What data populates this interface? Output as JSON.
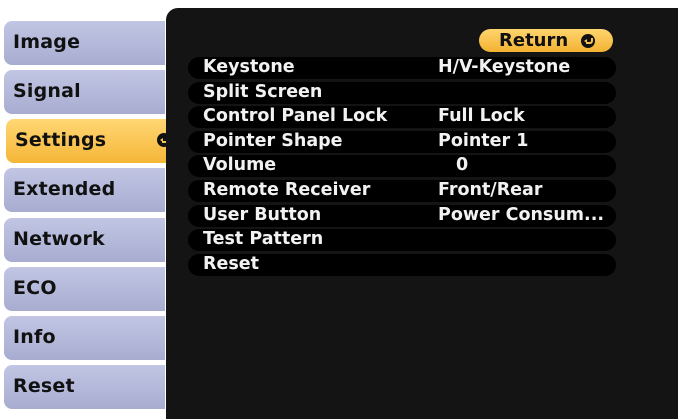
{
  "sidebar": {
    "tabs": [
      {
        "label": "Image",
        "active": false
      },
      {
        "label": "Signal",
        "active": false
      },
      {
        "label": "Settings",
        "active": true
      },
      {
        "label": "Extended",
        "active": false
      },
      {
        "label": "Network",
        "active": false
      },
      {
        "label": "ECO",
        "active": false
      },
      {
        "label": "Info",
        "active": false
      },
      {
        "label": "Reset",
        "active": false
      }
    ]
  },
  "main": {
    "return_label": "Return",
    "items": [
      {
        "label": "Keystone",
        "value": "H/V-Keystone"
      },
      {
        "label": "Split Screen",
        "value": ""
      },
      {
        "label": "Control Panel Lock",
        "value": "Full Lock"
      },
      {
        "label": "Pointer Shape",
        "value": "Pointer 1"
      },
      {
        "label": "Volume",
        "value": "0"
      },
      {
        "label": "Remote Receiver",
        "value": "Front/Rear"
      },
      {
        "label": "User Button",
        "value": "Power Consum..."
      },
      {
        "label": "Test Pattern",
        "value": ""
      },
      {
        "label": "Reset",
        "value": ""
      }
    ]
  },
  "colors": {
    "accent": "#f5b637",
    "inactive_tab": "#b4b8dc",
    "panel": "#141414",
    "row": "#000000",
    "text_light": "#f2f2f2"
  },
  "icons": {
    "enter": "enter-arrow-icon"
  }
}
